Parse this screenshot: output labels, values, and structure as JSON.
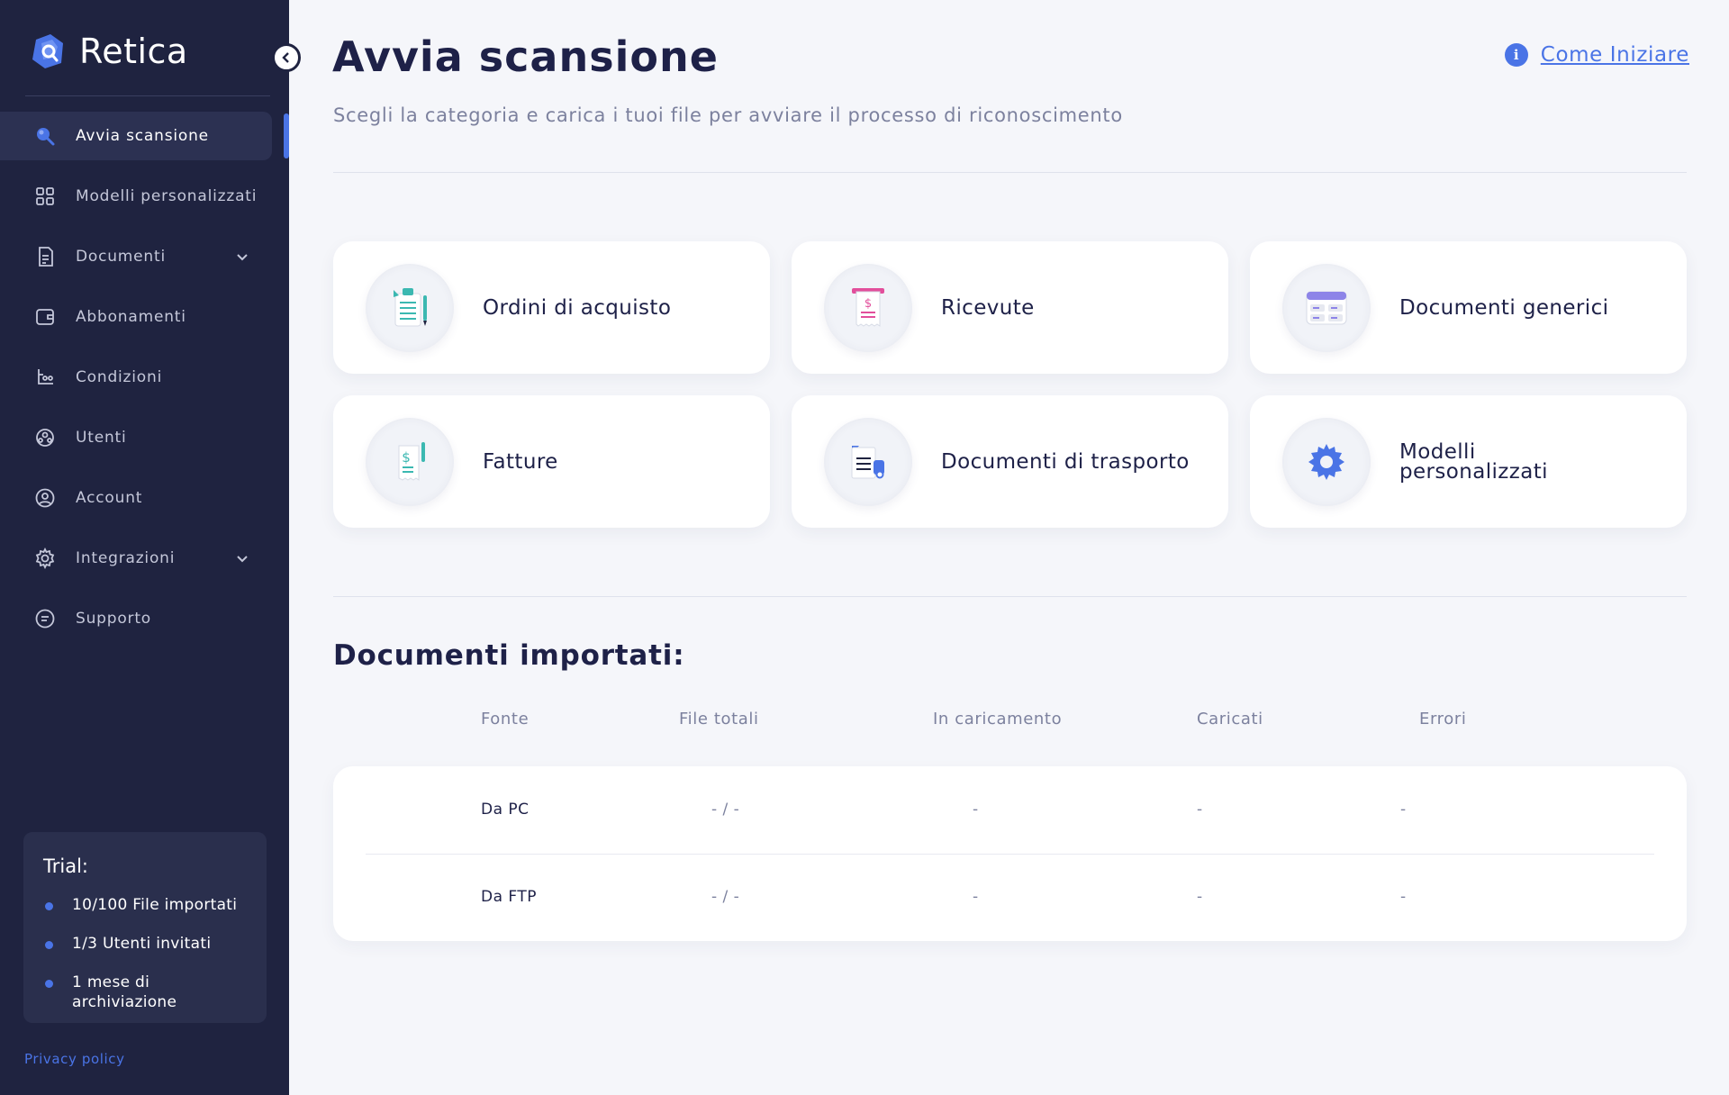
{
  "brand": {
    "name": "Retica"
  },
  "sidebar": {
    "items": [
      {
        "label": "Avvia scansione",
        "icon": "scan-icon",
        "active": true
      },
      {
        "label": "Modelli personalizzati",
        "icon": "grid-icon"
      },
      {
        "label": "Documenti",
        "icon": "document-icon",
        "expandable": true
      },
      {
        "label": "Abbonamenti",
        "icon": "wallet-icon"
      },
      {
        "label": "Condizioni",
        "icon": "conditions-icon"
      },
      {
        "label": "Utenti",
        "icon": "users-icon"
      },
      {
        "label": "Account",
        "icon": "account-icon"
      },
      {
        "label": "Integrazioni",
        "icon": "gear-icon",
        "expandable": true
      },
      {
        "label": "Supporto",
        "icon": "chat-icon"
      }
    ],
    "trial": {
      "title": "Trial:",
      "items": [
        "10/100 File importati",
        "1/3 Utenti invitati",
        "1 mese di archiviazione"
      ]
    },
    "privacy": "Privacy policy"
  },
  "header": {
    "title": "Avvia scansione",
    "help": "Come Iniziare",
    "subtitle": "Scegli la categoria e carica i tuoi file per avviare il processo di riconoscimento"
  },
  "categories": [
    {
      "label": "Ordini di acquisto",
      "icon": "purchase-order-icon"
    },
    {
      "label": "Ricevute",
      "icon": "receipt-icon"
    },
    {
      "label": "Documenti generici",
      "icon": "generic-document-icon"
    },
    {
      "label": "Fatture",
      "icon": "invoice-icon"
    },
    {
      "label": "Documenti di trasporto",
      "icon": "transport-document-icon"
    },
    {
      "label": "Modelli personalizzati",
      "icon": "custom-model-gear-icon"
    }
  ],
  "imports": {
    "title": "Documenti importati:",
    "columns": [
      "Fonte",
      "File totali",
      "In caricamento",
      "Caricati",
      "Errori"
    ],
    "rows": [
      [
        "Da PC",
        "- / -",
        "-",
        "-",
        "-"
      ],
      [
        "Da FTP",
        "- / -",
        "-",
        "-",
        "-"
      ]
    ]
  },
  "colors": {
    "sidebar": "#1f2340",
    "accent": "#4a74e6",
    "background": "#f5f6fa",
    "text": "#1e2148",
    "muted": "#7c819e"
  }
}
